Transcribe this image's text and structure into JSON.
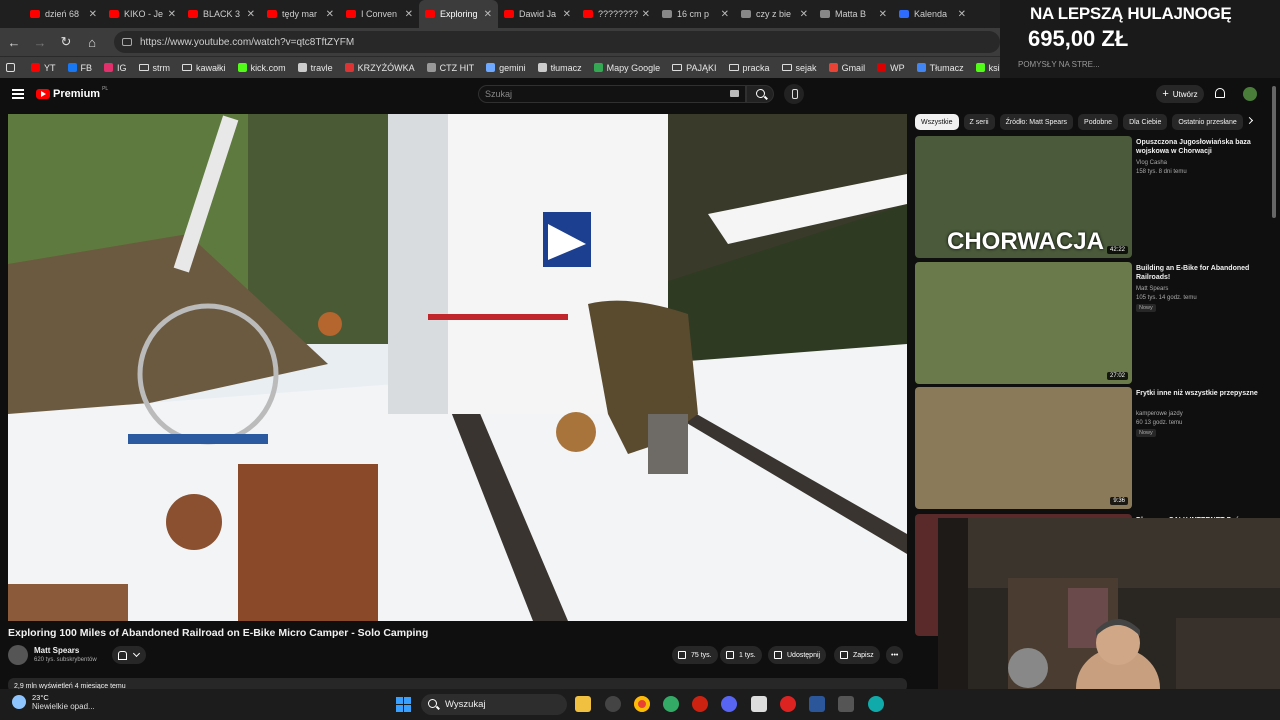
{
  "browser": {
    "tabs": [
      {
        "title": "dzień 68",
        "color": "#ff0000"
      },
      {
        "title": "KIKO - Je",
        "color": "#ff0000"
      },
      {
        "title": "BLACK 3",
        "color": "#ff0000"
      },
      {
        "title": "tędy mar",
        "color": "#ff0000"
      },
      {
        "title": "I Conven",
        "color": "#ff0000"
      },
      {
        "title": "Exploring",
        "color": "#ff0000",
        "active": true
      },
      {
        "title": "Dawid Ja",
        "color": "#ff0000"
      },
      {
        "title": "????????",
        "color": "#ff0000"
      },
      {
        "title": "16 cm p",
        "color": "#888888"
      },
      {
        "title": "czy z bie",
        "color": "#888888"
      },
      {
        "title": "Matta B",
        "color": "#888888"
      },
      {
        "title": "Kalenda",
        "color": "#2e6cff"
      }
    ],
    "url": "https://www.youtube.com/watch?v=qtc8TftZYFM",
    "bookmarks": [
      {
        "label": "YT",
        "icon": "youtube-icon",
        "color": "#ff0000"
      },
      {
        "label": "FB",
        "icon": "facebook-icon",
        "color": "#1877f2"
      },
      {
        "label": "IG",
        "icon": "instagram-icon",
        "color": "#e1306c"
      },
      {
        "label": "strm",
        "icon": "folder-icon"
      },
      {
        "label": "kawałki",
        "icon": "folder-icon"
      },
      {
        "label": "kick.com",
        "icon": "kick-icon",
        "color": "#53fc18"
      },
      {
        "label": "travle",
        "icon": "globe-icon",
        "color": "#cccccc"
      },
      {
        "label": "KRZYŻÓWKA",
        "icon": "puzzle-icon",
        "color": "#d33"
      },
      {
        "label": "CTZ HIT",
        "icon": "game-icon",
        "color": "#999"
      },
      {
        "label": "gemini",
        "icon": "gemini-icon",
        "color": "#6fa8ff"
      },
      {
        "label": "tłumacz",
        "icon": "translate-icon",
        "color": "#ccc"
      },
      {
        "label": "Mapy Google",
        "icon": "map-pin-icon",
        "color": "#34a853"
      },
      {
        "label": "PAJĄKI",
        "icon": "folder-icon"
      },
      {
        "label": "pracka",
        "icon": "folder-icon"
      },
      {
        "label": "sejak",
        "icon": "folder-icon"
      },
      {
        "label": "Gmail",
        "icon": "gmail-icon",
        "color": "#ea4335"
      },
      {
        "label": "WP",
        "icon": "wp-icon",
        "color": "#d00"
      },
      {
        "label": "Tłumacz",
        "icon": "translate-icon",
        "color": "#4285f4"
      },
      {
        "label": "ksiazka",
        "icon": "book-icon",
        "color": "#53fc18"
      }
    ]
  },
  "overlay": {
    "line1": "NA LEPSZĄ HULAJNOGĘ",
    "line2": "695,00 ZŁ",
    "line3": "POMYSŁY NA STRE..."
  },
  "youtube": {
    "logo_text": "Premium",
    "logo_region": "PL",
    "search_placeholder": "Szukaj",
    "create_label": "Utwórz",
    "video_title": "Exploring 100 Miles of Abandoned Railroad on E-Bike Micro Camper - Solo Camping",
    "channel_name": "Matt Spears",
    "channel_subs": "620 tys. subskrybentów",
    "likes": "75 tys.",
    "dislikes": "1 tys.",
    "share_label": "Udostępnij",
    "save_label": "Zapisz",
    "meta_line": "2,9 mln wyświetleń  4 miesiące temu",
    "chips": [
      "Wszystkie",
      "Z serii",
      "Źródło: Matt Spears",
      "Podobne",
      "Dla Ciebie",
      "Ostatnio przesłane"
    ],
    "recommendations": [
      {
        "title": "Opuszczona Jugosłowiańska baza wojskowa w Chorwacji",
        "channel": "Vlog Casha",
        "meta": "158 tys.  8 dni temu",
        "duration": "42:22",
        "thumb_text": "CHORWACJA",
        "badge": ""
      },
      {
        "title": "Building an E-Bike for Abandoned Railroads!",
        "channel": "Matt Spears",
        "meta": "105 tys.  14 godz. temu",
        "duration": "27:02",
        "thumb_text": "",
        "badge": "Nowy"
      },
      {
        "title": "Frytki inne niż wszystkie przepyszne",
        "channel": "kamperowe jazdy",
        "meta": "60  13 godz. temu",
        "duration": "9:36",
        "thumb_text": "",
        "badge": "Nowy"
      },
      {
        "title": "Dlaczego CAŁY INTERNET Znów",
        "channel": "",
        "meta": "",
        "duration": "",
        "thumb_text": "",
        "badge": ""
      }
    ]
  },
  "taskbar": {
    "temperature": "23°C",
    "weather": "Niewielkie opad...",
    "search_label": "Wyszukaj"
  }
}
